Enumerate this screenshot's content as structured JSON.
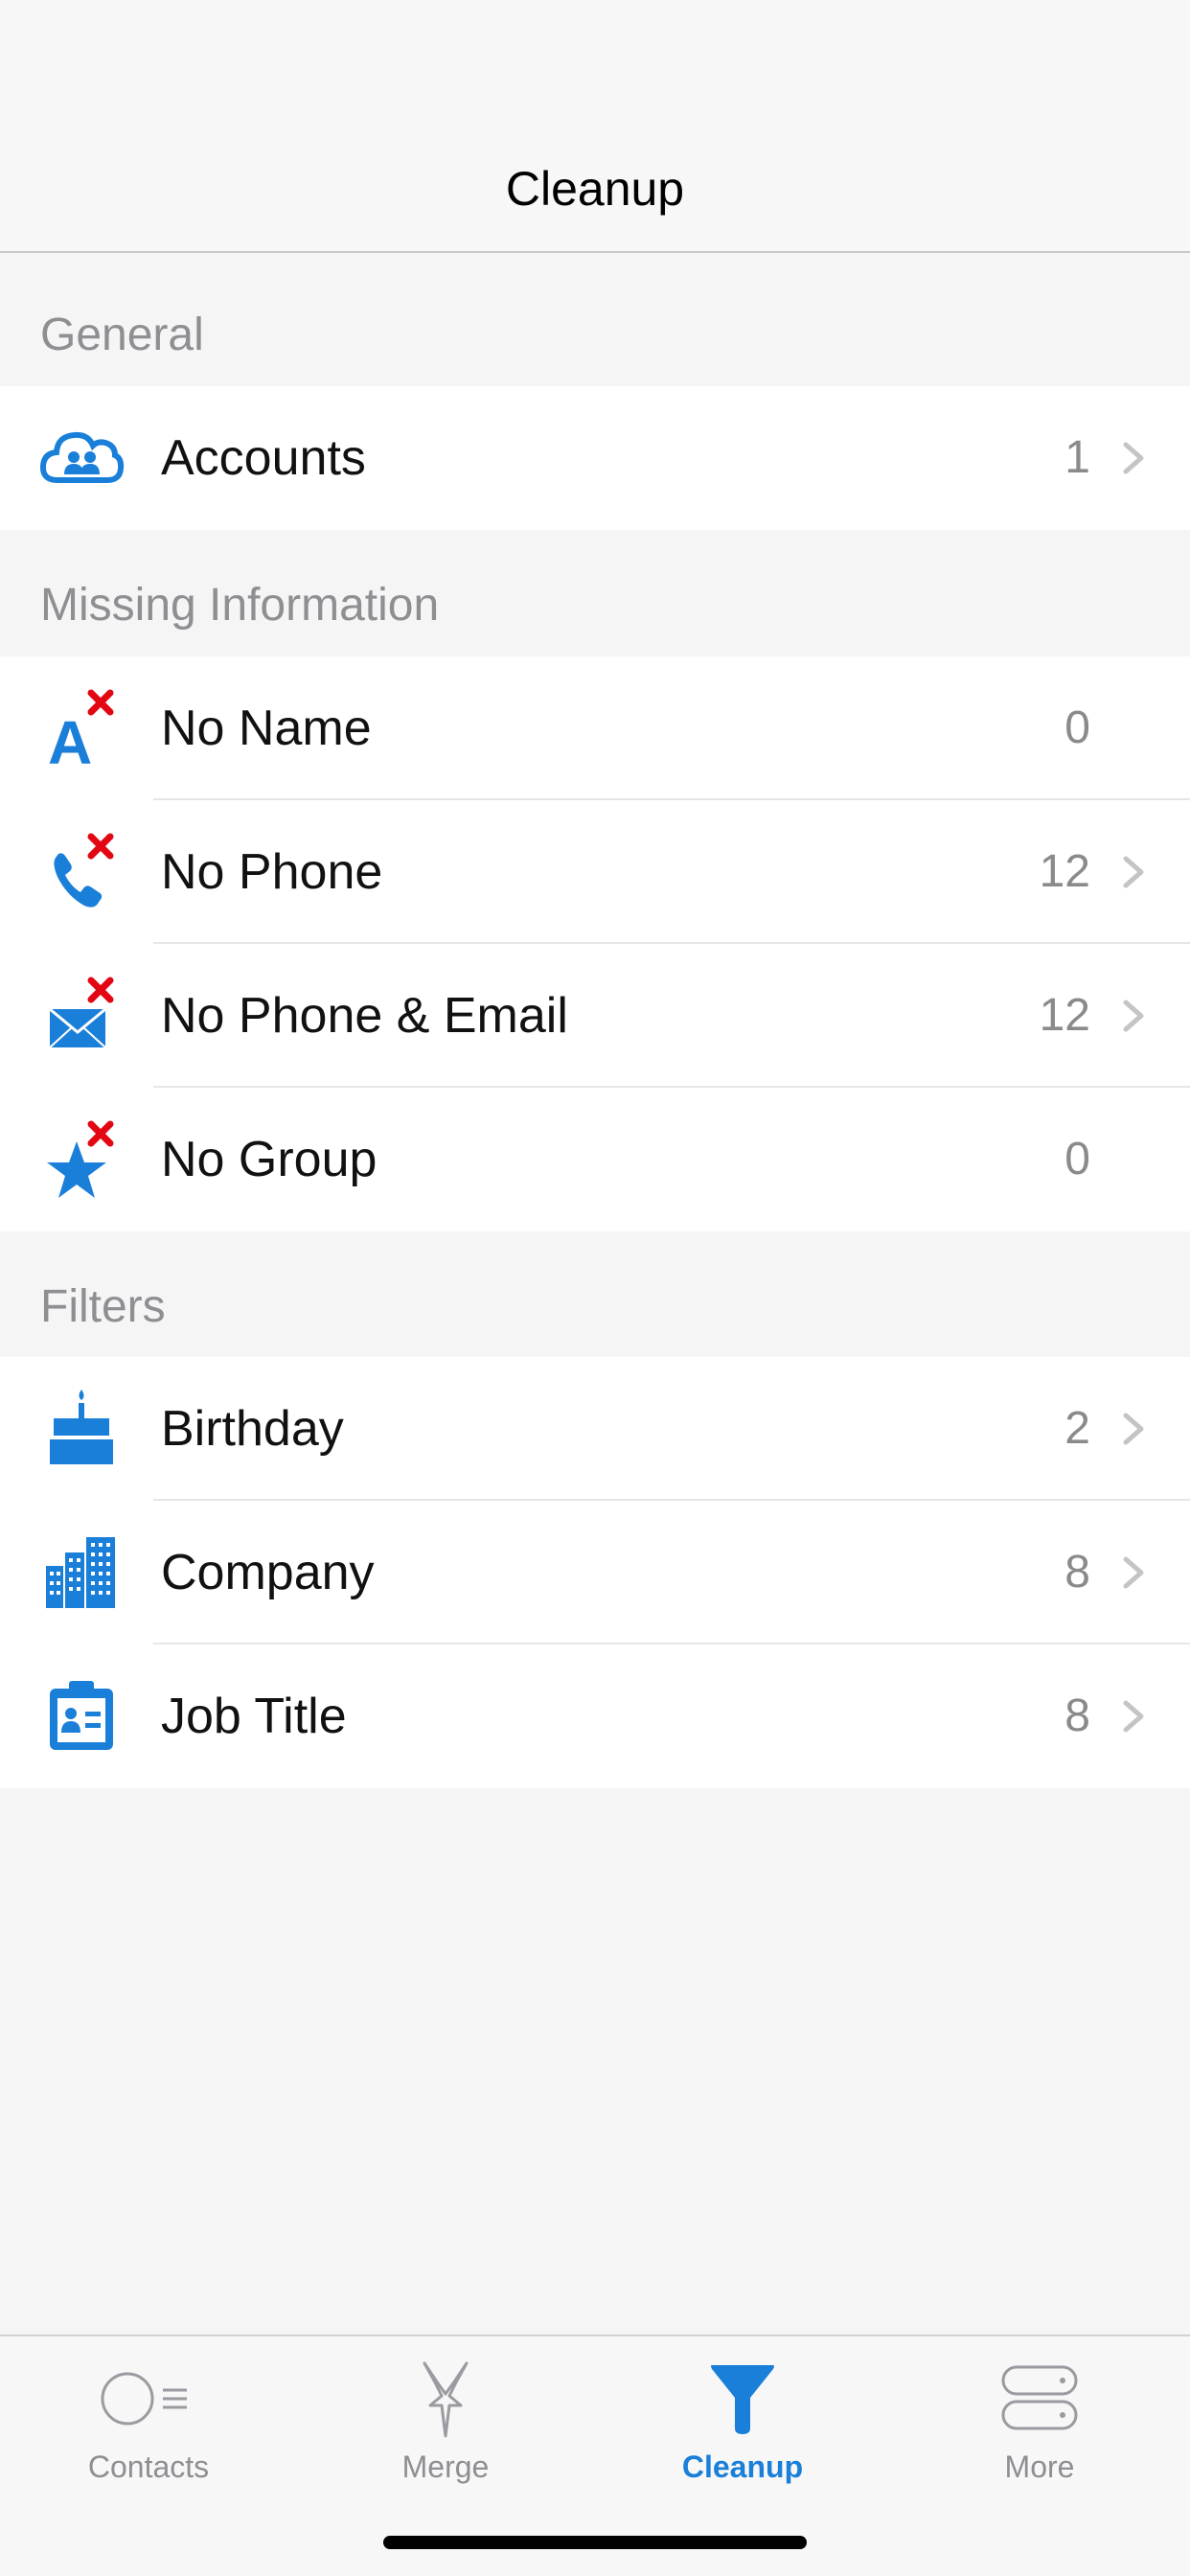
{
  "nav": {
    "title": "Cleanup"
  },
  "sections": {
    "general": {
      "header": "General",
      "rows": [
        {
          "label": "Accounts",
          "count": "1",
          "icon": "cloud-accounts-icon",
          "chevron": true
        }
      ]
    },
    "missing": {
      "header": "Missing Information",
      "rows": [
        {
          "label": "No Name",
          "count": "0",
          "icon": "no-name-icon",
          "chevron": false
        },
        {
          "label": "No Phone",
          "count": "12",
          "icon": "no-phone-icon",
          "chevron": true
        },
        {
          "label": "No Phone & Email",
          "count": "12",
          "icon": "no-email-icon",
          "chevron": true
        },
        {
          "label": "No Group",
          "count": "0",
          "icon": "no-group-icon",
          "chevron": false
        }
      ]
    },
    "filters": {
      "header": "Filters",
      "rows": [
        {
          "label": "Birthday",
          "count": "2",
          "icon": "birthday-cake-icon",
          "chevron": true
        },
        {
          "label": "Company",
          "count": "8",
          "icon": "company-building-icon",
          "chevron": true
        },
        {
          "label": "Job Title",
          "count": "8",
          "icon": "job-title-badge-icon",
          "chevron": true
        }
      ]
    }
  },
  "tabs": [
    {
      "label": "Contacts",
      "icon": "contacts-icon",
      "active": false
    },
    {
      "label": "Merge",
      "icon": "merge-icon",
      "active": false
    },
    {
      "label": "Cleanup",
      "icon": "funnel-icon",
      "active": true
    },
    {
      "label": "More",
      "icon": "more-icon",
      "active": false
    }
  ],
  "colors": {
    "accent": "#1a7fd9",
    "badge_red": "#e30613",
    "secondary_text": "#8e8e93"
  }
}
